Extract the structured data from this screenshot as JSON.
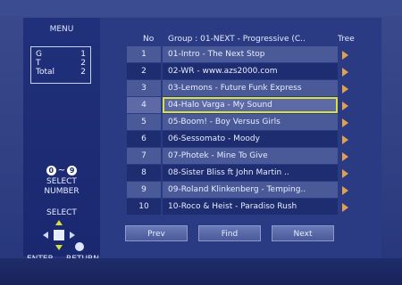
{
  "sidebar": {
    "menu_title": "MENU",
    "stats": [
      {
        "label": "G",
        "value": "1"
      },
      {
        "label": "T",
        "value": "2"
      },
      {
        "label": "Total",
        "value": "2"
      }
    ],
    "num_from": "0",
    "num_tilde": "~",
    "num_to": "9",
    "select_number_line1": "SELECT",
    "select_number_line2": "NUMBER",
    "select_label": "SELECT",
    "enter_label": "ENTER",
    "return_label": "RETURN"
  },
  "list": {
    "col_no": "No",
    "col_group": "Group : 01-NEXT - Progressive (C..",
    "col_tree": "Tree",
    "tracks": [
      {
        "no": "1",
        "title": "01-Intro - The Next Stop"
      },
      {
        "no": "2",
        "title": "02-WR - www.azs2000.com"
      },
      {
        "no": "3",
        "title": "03-Lemons - Future Funk Express"
      },
      {
        "no": "4",
        "title": "04-Halo Varga - My Sound"
      },
      {
        "no": "5",
        "title": "05-Boom! - Boy Versus Girls"
      },
      {
        "no": "6",
        "title": "06-Sessomato - Moody"
      },
      {
        "no": "7",
        "title": "07-Photek - Mine To Give"
      },
      {
        "no": "8",
        "title": "08-Sister Bliss ft John Martin .."
      },
      {
        "no": "9",
        "title": "09-Roland Klinkenberg - Temping.."
      },
      {
        "no": "10",
        "title": "10-Roco & Heist - Paradiso Rush"
      }
    ],
    "selected_index": 3,
    "pointer_index": 1
  },
  "buttons": {
    "prev": "Prev",
    "find": "Find",
    "next": "Next"
  },
  "colors": {
    "selection_outline": "#d6e040",
    "tree_arrow": "#e0a050"
  }
}
